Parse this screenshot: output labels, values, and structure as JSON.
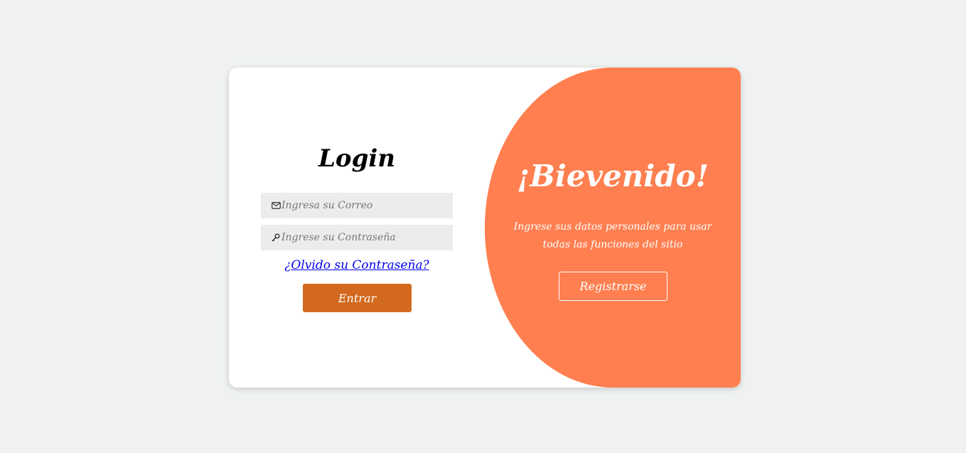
{
  "login": {
    "title": "Login",
    "email_placeholder": "Ingresa su Correo",
    "password_placeholder": "Ingrese su Contraseña",
    "forgot_link": "¿Olvido su Contraseña?",
    "submit_label": "Entrar",
    "icons": {
      "email": "envelope-icon",
      "password": "key-icon"
    }
  },
  "welcome": {
    "title": "¡Bievenido!",
    "text_line1": "Ingrese sus datos personales para usar",
    "text_line2": "todas las funciones del sitio",
    "register_label": "Registrarse"
  },
  "colors": {
    "background": "#eff2f1",
    "panel": "#ff7f50",
    "button": "#d2691e",
    "field": "#ececec",
    "link": "#0000ee"
  }
}
